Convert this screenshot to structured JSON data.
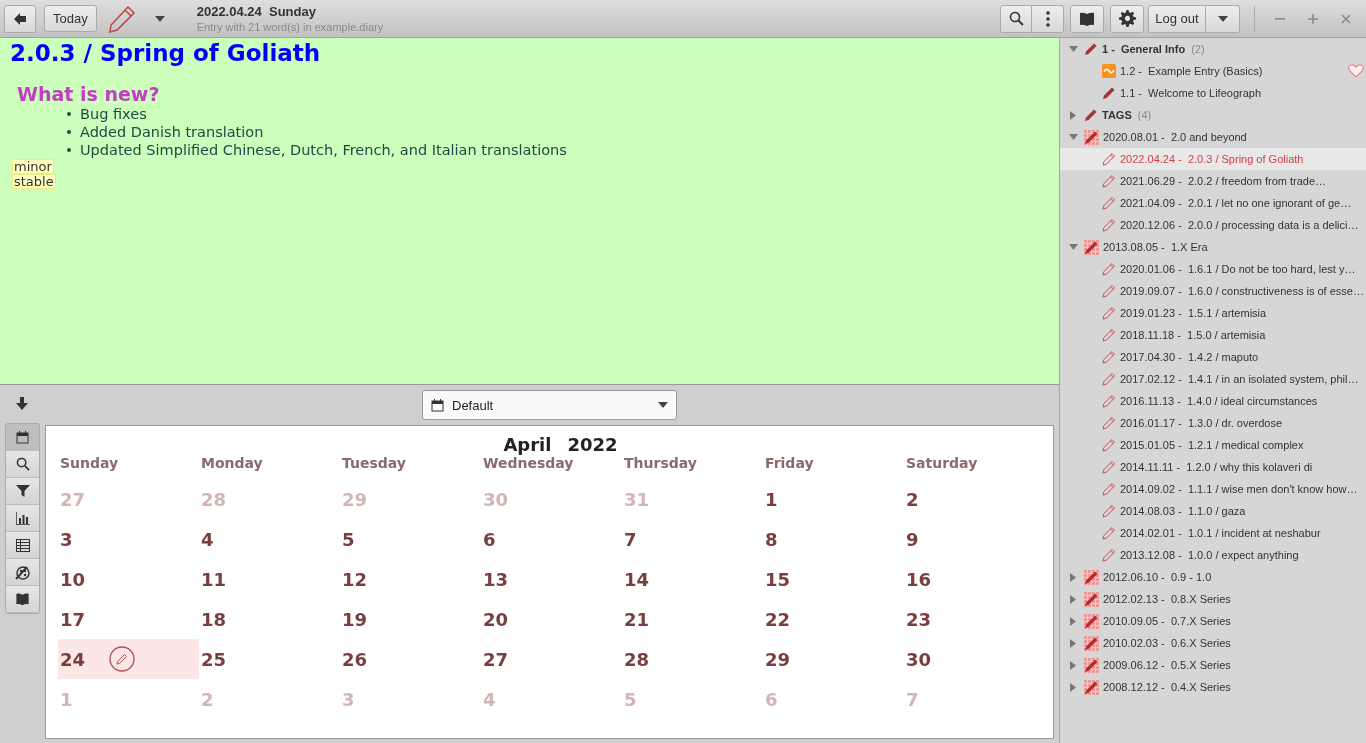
{
  "toolbar": {
    "today_label": "Today",
    "title": "2022.04.24  Sunday",
    "subtitle": "Entry with 21 word(s) in example.diary",
    "logout_label": "Log out"
  },
  "editor": {
    "title": "2.0.3 / Spring of Goliath",
    "heading": "What is new?",
    "bullets": [
      "Bug fixes",
      "Added Danish translation",
      "Updated Simplified Chinese, Dutch, French, and Italian translations"
    ],
    "tags": [
      "minor",
      "stable"
    ]
  },
  "filter": {
    "value": "Default"
  },
  "tools": [
    {
      "kind": "calendar",
      "selected": true
    },
    {
      "kind": "search",
      "selected": false
    },
    {
      "kind": "filter",
      "selected": false
    },
    {
      "kind": "chart",
      "selected": false
    },
    {
      "kind": "table",
      "selected": false
    },
    {
      "kind": "theme",
      "selected": false
    },
    {
      "kind": "map",
      "selected": false
    }
  ],
  "calendar": {
    "month": "April",
    "year": "2022",
    "weekdays": [
      "Sunday",
      "Monday",
      "Tuesday",
      "Wednesday",
      "Thursday",
      "Friday",
      "Saturday"
    ],
    "weeks": [
      [
        {
          "day": "27",
          "other_month": true
        },
        {
          "day": "28",
          "other_month": true
        },
        {
          "day": "29",
          "other_month": true
        },
        {
          "day": "30",
          "other_month": true
        },
        {
          "day": "31",
          "other_month": true
        },
        {
          "day": "1",
          "other_month": false
        },
        {
          "day": "2",
          "other_month": false
        }
      ],
      [
        {
          "day": "3",
          "other_month": false
        },
        {
          "day": "4",
          "other_month": false
        },
        {
          "day": "5",
          "other_month": false
        },
        {
          "day": "6",
          "other_month": false
        },
        {
          "day": "7",
          "other_month": false
        },
        {
          "day": "8",
          "other_month": false
        },
        {
          "day": "9",
          "other_month": false
        }
      ],
      [
        {
          "day": "10",
          "other_month": false
        },
        {
          "day": "11",
          "other_month": false
        },
        {
          "day": "12",
          "other_month": false
        },
        {
          "day": "13",
          "other_month": false
        },
        {
          "day": "14",
          "other_month": false
        },
        {
          "day": "15",
          "other_month": false
        },
        {
          "day": "16",
          "other_month": false
        }
      ],
      [
        {
          "day": "17",
          "other_month": false
        },
        {
          "day": "18",
          "other_month": false
        },
        {
          "day": "19",
          "other_month": false
        },
        {
          "day": "20",
          "other_month": false
        },
        {
          "day": "21",
          "other_month": false
        },
        {
          "day": "22",
          "other_month": false
        },
        {
          "day": "23",
          "other_month": false
        }
      ],
      [
        {
          "day": "24",
          "other_month": false,
          "selected": true,
          "has_entry": true
        },
        {
          "day": "25",
          "other_month": false
        },
        {
          "day": "26",
          "other_month": false
        },
        {
          "day": "27",
          "other_month": false
        },
        {
          "day": "28",
          "other_month": false
        },
        {
          "day": "29",
          "other_month": false
        },
        {
          "day": "30",
          "other_month": false
        }
      ],
      [
        {
          "day": "1",
          "other_month": true
        },
        {
          "day": "2",
          "other_month": true
        },
        {
          "day": "3",
          "other_month": true
        },
        {
          "day": "4",
          "other_month": true
        },
        {
          "day": "5",
          "other_month": true
        },
        {
          "day": "6",
          "other_month": true
        },
        {
          "day": "7",
          "other_month": true
        }
      ]
    ]
  },
  "tree": [
    {
      "kind": "category",
      "label": "1 -  General Info",
      "count": "(2)",
      "expanded": true,
      "selected": false,
      "children": [
        {
          "kind": "todo",
          "label": "1.2 -  Example Entry (Basics)",
          "favorite": true,
          "selected": false
        },
        {
          "kind": "note",
          "label": "1.1 -  Welcome to Lifeograph",
          "selected": false
        }
      ]
    },
    {
      "kind": "category",
      "label": "TAGS",
      "count": "(4)",
      "expanded": false,
      "selected": false
    },
    {
      "kind": "chapter",
      "label": "2020.08.01 -  2.0 and beyond",
      "expanded": true,
      "selected": false,
      "children": [
        {
          "kind": "entry",
          "label": "2022.04.24 -  2.0.3 / Spring of Goliath",
          "selected": true
        },
        {
          "kind": "entry",
          "label": "2021.06.29 -  2.0.2 / freedom from trade…",
          "selected": false
        },
        {
          "kind": "entry",
          "label": "2021.04.09 -  2.0.1 / let no one ignorant of ge…",
          "selected": false
        },
        {
          "kind": "entry",
          "label": "2020.12.06 -  2.0.0 / processing data is a delici…",
          "selected": false
        }
      ]
    },
    {
      "kind": "chapter",
      "label": "2013.08.05 -  1.X Era",
      "expanded": true,
      "selected": false,
      "children": [
        {
          "kind": "entry",
          "label": "2020.01.06 -  1.6.1 / Do not be too hard, lest y…",
          "selected": false
        },
        {
          "kind": "entry",
          "label": "2019.09.07 -  1.6.0 / constructiveness is of esse…",
          "selected": false
        },
        {
          "kind": "entry",
          "label": "2019.01.23 -  1.5.1 / artemisia",
          "selected": false
        },
        {
          "kind": "entry",
          "label": "2018.11.18 -  1.5.0 / artemisia",
          "selected": false
        },
        {
          "kind": "entry",
          "label": "2017.04.30 -  1.4.2 / maputo",
          "selected": false
        },
        {
          "kind": "entry",
          "label": "2017.02.12 -  1.4.1 / in an isolated system, phil…",
          "selected": false
        },
        {
          "kind": "entry",
          "label": "2016.11.13 -  1.4.0 / ideal circumstances",
          "selected": false
        },
        {
          "kind": "entry",
          "label": "2016.01.17 -  1.3.0 / dr. overdose",
          "selected": false
        },
        {
          "kind": "entry",
          "label": "2015.01.05 -  1.2.1 / medical complex",
          "selected": false
        },
        {
          "kind": "entry",
          "label": "2014.11.11 -  1.2.0 / why this kolaveri di",
          "selected": false
        },
        {
          "kind": "entry",
          "label": "2014.09.02 -  1.1.1 / wise men don't know how…",
          "selected": false
        },
        {
          "kind": "entry",
          "label": "2014.08.03 -  1.1.0 / gaza",
          "selected": false
        },
        {
          "kind": "entry",
          "label": "2014.02.01 -  1.0.1 / incident at neshabur",
          "selected": false
        },
        {
          "kind": "entry",
          "label": "2013.12.08 -  1.0.0 / expect anything",
          "selected": false
        }
      ]
    },
    {
      "kind": "chapter",
      "label": "2012.06.10 -  0.9 - 1.0",
      "expanded": false,
      "selected": false
    },
    {
      "kind": "chapter",
      "label": "2012.02.13 -  0.8.X Series",
      "expanded": false,
      "selected": false
    },
    {
      "kind": "chapter",
      "label": "2010.09.05 -  0.7.X Series",
      "expanded": false,
      "selected": false
    },
    {
      "kind": "chapter",
      "label": "2010.02.03 -  0.6.X Series",
      "expanded": false,
      "selected": false
    },
    {
      "kind": "chapter",
      "label": "2009.06.12 -  0.5.X Series",
      "expanded": false,
      "selected": false
    },
    {
      "kind": "chapter",
      "label": "2008.12.12 -  0.4.X Series",
      "expanded": false,
      "selected": false
    }
  ]
}
